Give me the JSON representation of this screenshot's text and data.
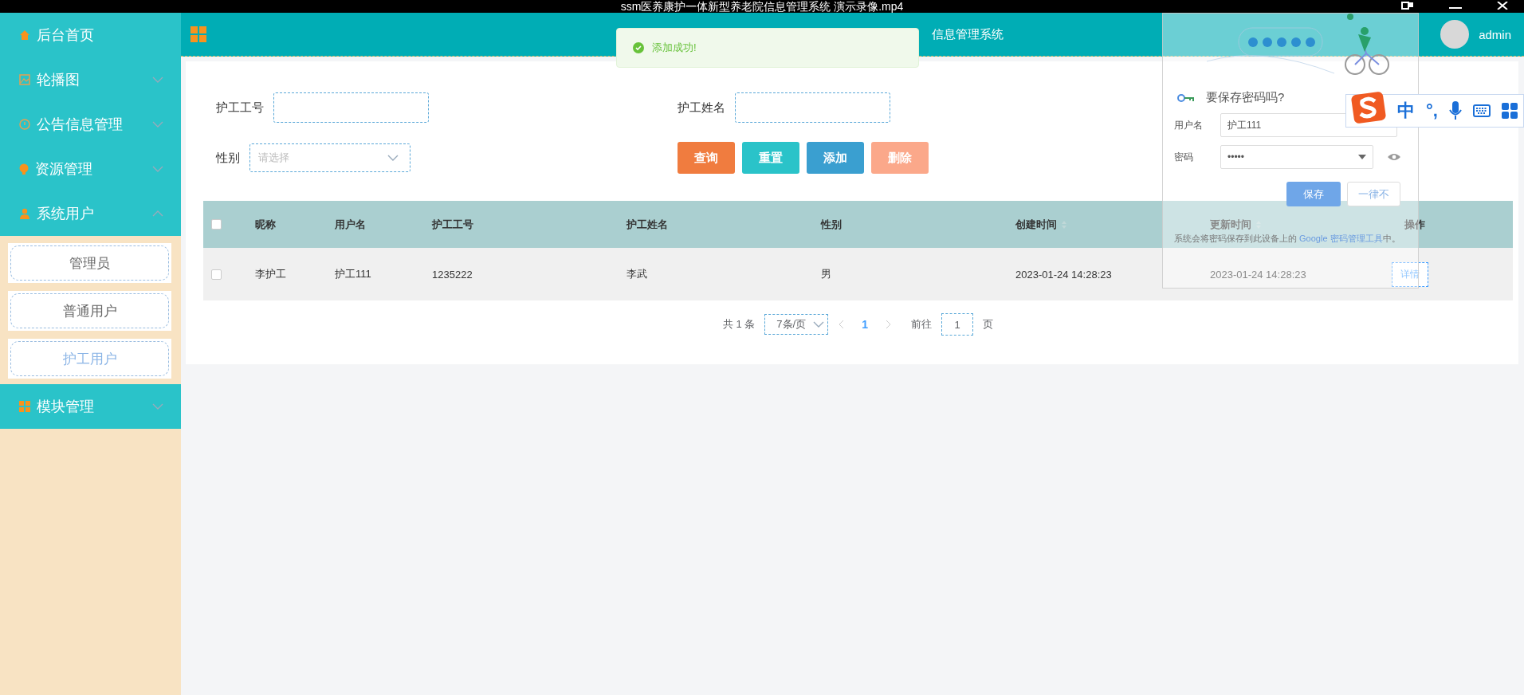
{
  "video_title": "ssm医养康护一体新型养老院信息管理系统 演示录像.mp4",
  "sidebar": {
    "items": [
      {
        "label": "后台首页",
        "kind": "link"
      },
      {
        "label": "轮播图",
        "kind": "menu",
        "expanded": false
      },
      {
        "label": "公告信息管理",
        "kind": "menu",
        "expanded": false
      },
      {
        "label": "资源管理",
        "kind": "menu",
        "expanded": false
      },
      {
        "label": "系统用户",
        "kind": "menu",
        "expanded": true,
        "children": [
          {
            "label": "管理员",
            "selected": false
          },
          {
            "label": "普通用户",
            "selected": false
          },
          {
            "label": "护工用户",
            "selected": true
          }
        ]
      },
      {
        "label": "模块管理",
        "kind": "menu",
        "expanded": false
      }
    ]
  },
  "header": {
    "title": "信息管理系统",
    "user": "admin"
  },
  "toast": {
    "message": "添加成功!"
  },
  "search": {
    "fields": [
      {
        "label": "护工工号",
        "kind": "text"
      },
      {
        "label": "护工姓名",
        "kind": "text"
      },
      {
        "label": "性别",
        "kind": "select",
        "placeholder": "请选择"
      }
    ],
    "buttons": [
      {
        "label": "查询",
        "color": "#f07c3f"
      },
      {
        "label": "重置",
        "color": "#2ac3c9"
      },
      {
        "label": "添加",
        "color": "#3a9fd0"
      },
      {
        "label": "删除",
        "color": "#fba88a"
      }
    ]
  },
  "table": {
    "all_checked": false,
    "columns": [
      {
        "label": "昵称",
        "sortable": false
      },
      {
        "label": "用户名",
        "sortable": false
      },
      {
        "label": "护工工号",
        "sortable": false
      },
      {
        "label": "护工姓名",
        "sortable": false
      },
      {
        "label": "性别",
        "sortable": false
      },
      {
        "label": "创建时间",
        "sortable": true
      },
      {
        "label": "更新时间",
        "sortable": true
      },
      {
        "label": "操作",
        "sortable": false
      }
    ],
    "rows": [
      {
        "checked": false,
        "cells": [
          "李护工",
          "护工111",
          "1235222",
          "李武",
          "男",
          "2023-01-24 14:28:23",
          "2023-01-24 14:28:23"
        ],
        "action": "详情"
      }
    ]
  },
  "pagination": {
    "total": "共 1 条",
    "page_size": "7条/页",
    "pages": [
      {
        "label": "1",
        "selected": true
      }
    ],
    "goto_label": "前往",
    "goto_value": "1",
    "goto_suffix": "页"
  },
  "password_popup": {
    "title": "要保存密码吗?",
    "username_label": "用户名",
    "username": "护工111",
    "password_label": "密码",
    "password": "•••••",
    "save": "保存",
    "never": "一律不",
    "note": "系统会将密码保存到此设备上的 ",
    "link": "Google 密码管理工具",
    "note_end": "中。"
  },
  "ime": {
    "mode": "中",
    "punct": "°,"
  }
}
